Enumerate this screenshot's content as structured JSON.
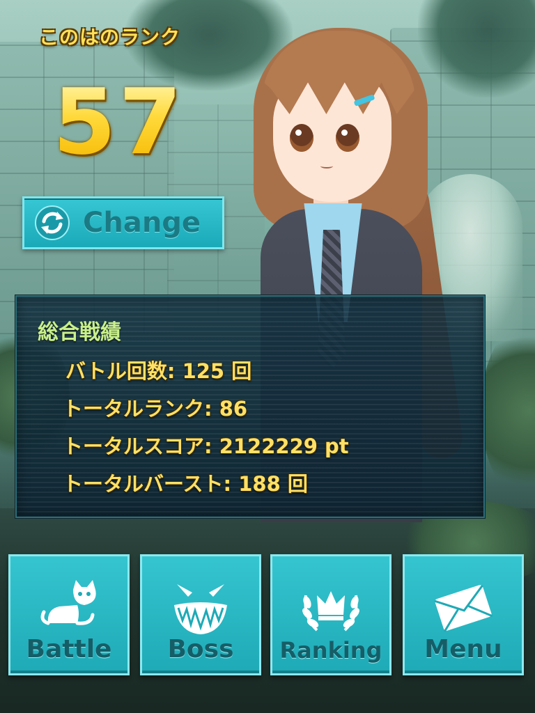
{
  "header": {
    "rank_title": "このはのランク",
    "rank_value": "57",
    "change_label": "Change"
  },
  "stats": {
    "title": "総合戦績",
    "lines": [
      "バトル回数: 125 回",
      "トータルランク: 86",
      "トータルスコア: 2122229 pt",
      "トータルバースト: 188 回"
    ]
  },
  "nav": {
    "items": [
      {
        "label": "Battle",
        "icon": "cat-icon"
      },
      {
        "label": "Boss",
        "icon": "boss-face-icon"
      },
      {
        "label": "Ranking",
        "icon": "crown-laurel-icon"
      },
      {
        "label": "Menu",
        "icon": "envelope-icon"
      }
    ]
  },
  "colors": {
    "accent": "#1eaab6",
    "rank_gold": "#ffd93a",
    "stat_text": "#ffe066",
    "stats_title": "#c9f08a"
  }
}
